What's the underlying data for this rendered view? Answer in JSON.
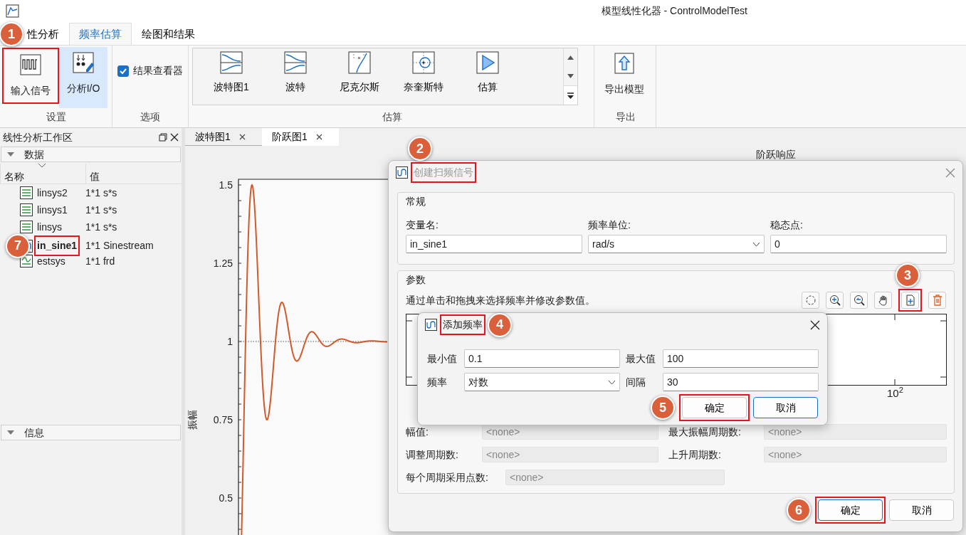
{
  "window": {
    "title": "模型线性化器 - ControlModelTest"
  },
  "ribbon": {
    "tabs": [
      {
        "label": "性分析",
        "selected": false
      },
      {
        "label": "频率估算",
        "selected": true
      },
      {
        "label": "绘图和结果",
        "selected": false
      }
    ],
    "groups": [
      {
        "label": "设置",
        "items": [
          {
            "kind": "button",
            "label": "输入信号",
            "selected": false,
            "callout": "1"
          },
          {
            "kind": "button",
            "label": "分析I/O",
            "selected": true
          }
        ]
      },
      {
        "label": "选项",
        "items": [
          {
            "kind": "checkbox",
            "label": "结果查看器",
            "checked": true
          }
        ]
      },
      {
        "label": "估算",
        "items": [
          {
            "kind": "gallery",
            "entries": [
              "波特图1",
              "波特",
              "尼克尔斯",
              "奈奎斯特",
              "估算"
            ]
          }
        ]
      },
      {
        "label": "导出",
        "items": [
          {
            "kind": "button",
            "label": "导出模型",
            "selected": false
          }
        ]
      }
    ]
  },
  "workspace": {
    "title": "线性分析工作区",
    "sections": [
      {
        "label": "数据",
        "expanded": true,
        "columns": [
          "名称",
          "值"
        ],
        "rows": [
          {
            "kind": "ss",
            "name": "linsys2",
            "value": "1*1 s*s",
            "selected": false
          },
          {
            "kind": "ss",
            "name": "linsys1",
            "value": "1*1 s*s",
            "selected": false
          },
          {
            "kind": "ss",
            "name": "linsys",
            "value": "1*1 s*s",
            "selected": false
          },
          {
            "kind": "sinestream",
            "name": "in_sine1",
            "value": "1*1 Sinestream",
            "selected": true,
            "callout": "7"
          },
          {
            "kind": "frd",
            "name": "estsys",
            "value": "1*1 frd",
            "selected": false
          }
        ]
      },
      {
        "label": "信息",
        "expanded": true
      }
    ]
  },
  "documents": {
    "tabs": [
      {
        "label": "波特图1",
        "selected": false
      },
      {
        "label": "阶跃图1",
        "selected": true
      }
    ],
    "plot": {
      "title": "阶跃响应",
      "ylabel": "振幅",
      "yticks": [
        "1.5",
        "1.25",
        "1",
        "0.75",
        "0.5"
      ]
    }
  },
  "sweep_dialog": {
    "title": "创建扫频信号",
    "active": false,
    "callout": "2",
    "general": {
      "label": "常规",
      "fields": [
        {
          "kind": "text",
          "label": "变量名:",
          "value": "in_sine1"
        },
        {
          "kind": "select",
          "label": "频率单位:",
          "value": "rad/s"
        },
        {
          "kind": "text",
          "label": "稳态点:",
          "value": "0"
        }
      ]
    },
    "parameters": {
      "label": "参数",
      "hint": "通过单击和拖拽来选择频率并修改参数值。",
      "tools": [
        {
          "kind": "fit"
        },
        {
          "kind": "zoom-in"
        },
        {
          "kind": "zoom-out"
        },
        {
          "kind": "pan"
        },
        {
          "kind": "add",
          "callout": "3"
        },
        {
          "kind": "delete"
        }
      ],
      "plot": {
        "xtick": "10$^{2}$"
      },
      "fields": [
        {
          "label": "幅值:",
          "value": "<none>",
          "disabled": true
        },
        {
          "label": "最大振幅周期数:",
          "value": "<none>",
          "disabled": true
        },
        {
          "label": "调整周期数:",
          "value": "<none>",
          "disabled": true
        },
        {
          "label": "上升周期数:",
          "value": "<none>",
          "disabled": true
        },
        {
          "label": "每个周期采用点数:",
          "value": "<none>",
          "disabled": true
        }
      ]
    },
    "buttons": [
      {
        "label": "确定",
        "default": true,
        "callout": "6"
      },
      {
        "label": "取消",
        "default": false
      }
    ]
  },
  "add_dialog": {
    "title": "添加频率",
    "active": true,
    "callout": "4",
    "fields": [
      {
        "kind": "text",
        "label": "最小值",
        "value": "0.1"
      },
      {
        "kind": "text",
        "label": "最大值",
        "value": "100"
      },
      {
        "kind": "select",
        "label": "频率",
        "value": "对数"
      },
      {
        "kind": "text",
        "label": "间隔",
        "value": "30"
      }
    ],
    "buttons": [
      {
        "label": "确定",
        "default": false,
        "callout": "5"
      },
      {
        "label": "取消",
        "default": true
      }
    ]
  }
}
